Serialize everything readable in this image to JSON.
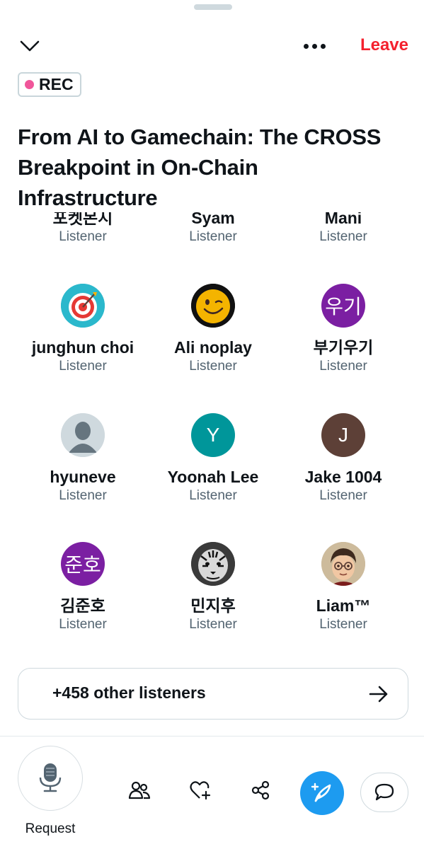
{
  "header": {
    "leave_label": "Leave",
    "rec_label": "REC"
  },
  "space": {
    "title": "From AI to Gamechain: The CROSS Breakpoint in On-Chain Infrastructure"
  },
  "listeners": [
    {
      "name": "포켓몬시",
      "role": "Listener",
      "avatar": "partial"
    },
    {
      "name": "Syam",
      "role": "Listener",
      "avatar": "partial"
    },
    {
      "name": "Mani",
      "role": "Listener",
      "avatar": "partial"
    },
    {
      "name": "junghun choi",
      "role": "Listener",
      "avatar": "target-icon"
    },
    {
      "name": "Ali noplay",
      "role": "Listener",
      "avatar": "winking-smiley-icon"
    },
    {
      "name": "부기우기",
      "role": "Listener",
      "avatar_text": "우기",
      "avatar_color": "#7b1fa2"
    },
    {
      "name": "hyuneve",
      "role": "Listener",
      "avatar": "default-user-icon"
    },
    {
      "name": "Yoonah Lee",
      "role": "Listener",
      "avatar_text": "Y",
      "avatar_color": "#00969a"
    },
    {
      "name": "Jake 1004",
      "role": "Listener",
      "avatar_text": "J",
      "avatar_color": "#5d4037"
    },
    {
      "name": "김준호",
      "role": "Listener",
      "avatar_text": "준호",
      "avatar_color": "#7b1fa2"
    },
    {
      "name": "민지후",
      "role": "Listener",
      "avatar": "tiger-photo"
    },
    {
      "name": "Liam™",
      "role": "Listener",
      "avatar": "cartoon-boy-photo"
    }
  ],
  "others": {
    "label": "+458 other listeners"
  },
  "bottom": {
    "request_label": "Request"
  },
  "colors": {
    "leave": "#f4212e",
    "rec_dot": "#f0569a",
    "compose": "#1d9bf0"
  }
}
